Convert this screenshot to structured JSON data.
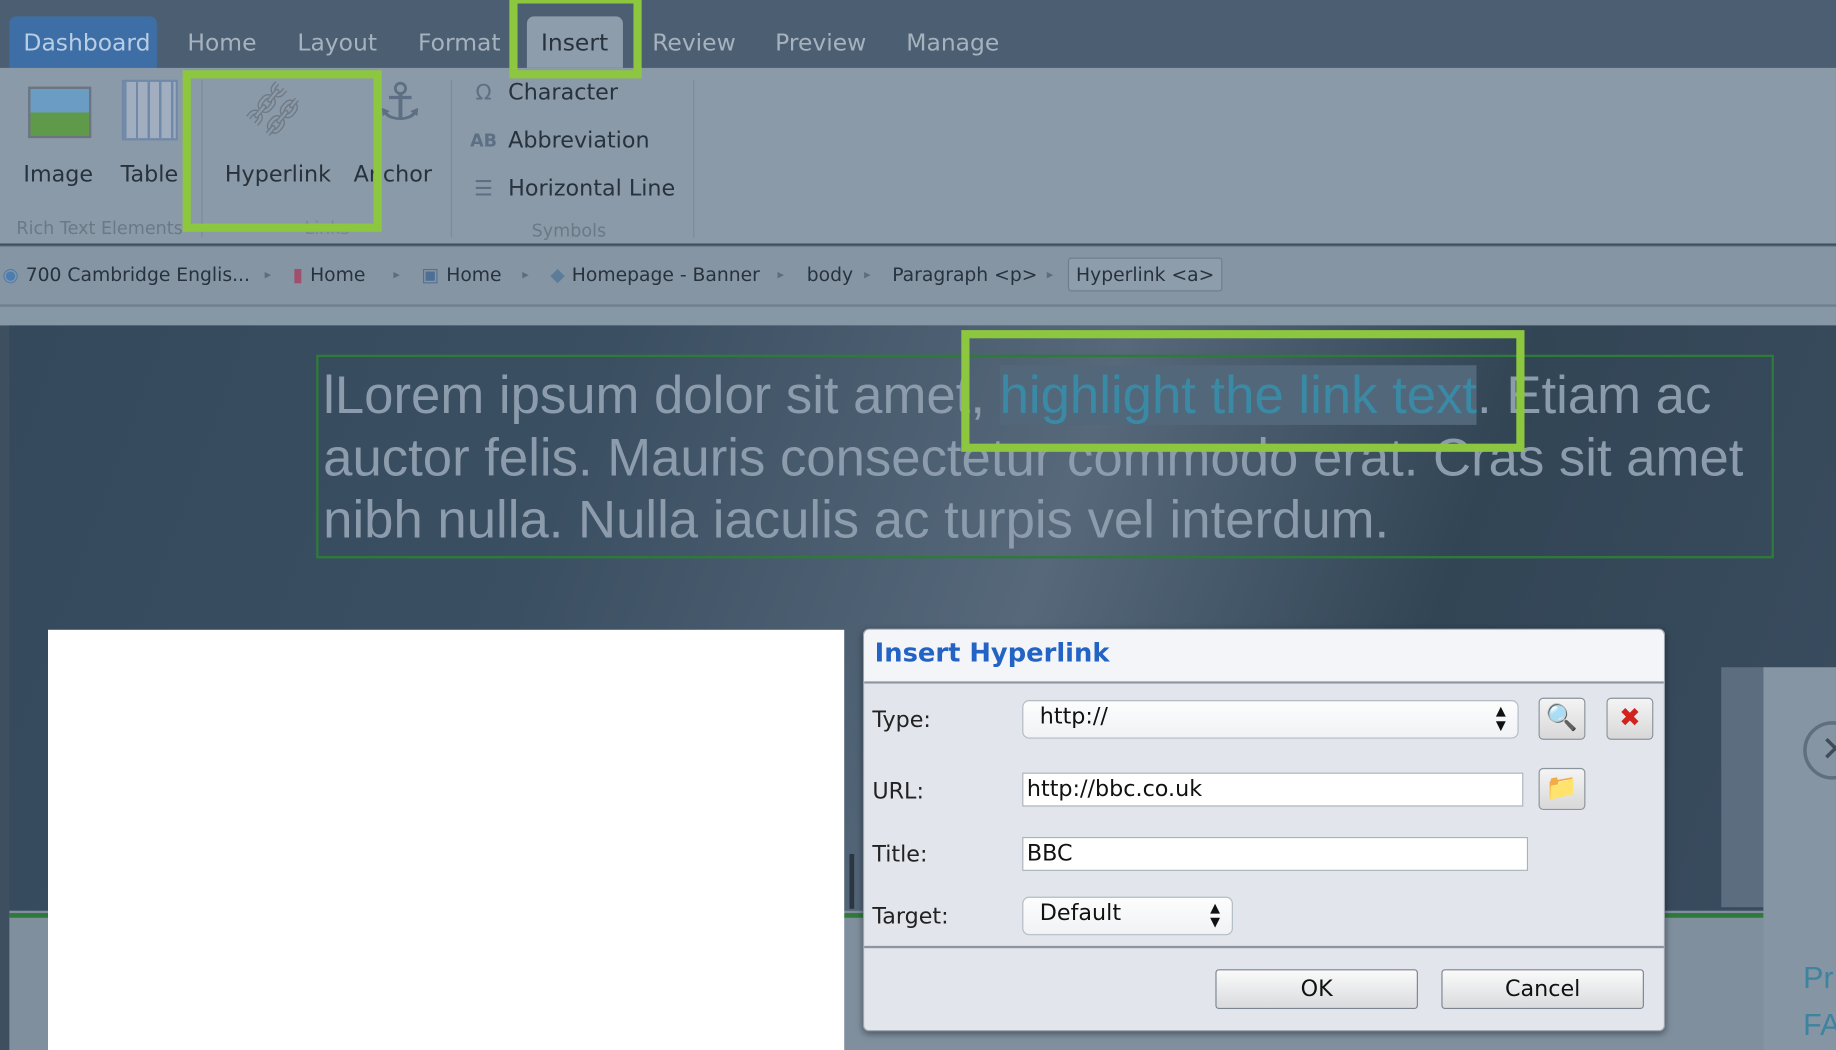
{
  "tabs": [
    "Dashboard",
    "Home",
    "Layout",
    "Format",
    "Insert",
    "Review",
    "Preview",
    "Manage"
  ],
  "active_tab": "Insert",
  "ribbon": {
    "rich_text": {
      "group": "Rich Text Elements",
      "items": [
        "Image",
        "Table"
      ]
    },
    "links": {
      "group": "Links",
      "items": [
        "Hyperlink",
        "Anchor"
      ]
    },
    "symbols": {
      "group": "Symbols",
      "items": [
        "Character",
        "Abbreviation",
        "Horizontal Line"
      ]
    }
  },
  "breadcrumb": [
    "700 Cambridge Englis...",
    "Home",
    "Home",
    "Homepage - Banner",
    "body",
    "Paragraph <p>",
    "Hyperlink <a>"
  ],
  "content": {
    "before": "lLorem ipsum dolor sit amet, ",
    "highlight": "highlight the link text",
    "after": ". Etiam ac auctor felis. Mauris consectetur commodo erat. Cras sit amet nibh nulla. Nulla iaculis ac turpis vel interdum."
  },
  "right_panel": {
    "lines": [
      "Pr",
      "FA"
    ]
  },
  "dialog": {
    "title": "Insert Hyperlink",
    "type_label": "Type:",
    "type_value": "http://",
    "url_label": "URL:",
    "url_value": "http://bbc.co.uk",
    "title_label": "Title:",
    "title_value": "BBC",
    "target_label": "Target:",
    "target_value": "Default",
    "ok": "OK",
    "cancel": "Cancel"
  },
  "colors": {
    "callout": "#8dc63f",
    "dialog_title": "#2363c4",
    "tab_dashboard": "#3d6fa6"
  }
}
